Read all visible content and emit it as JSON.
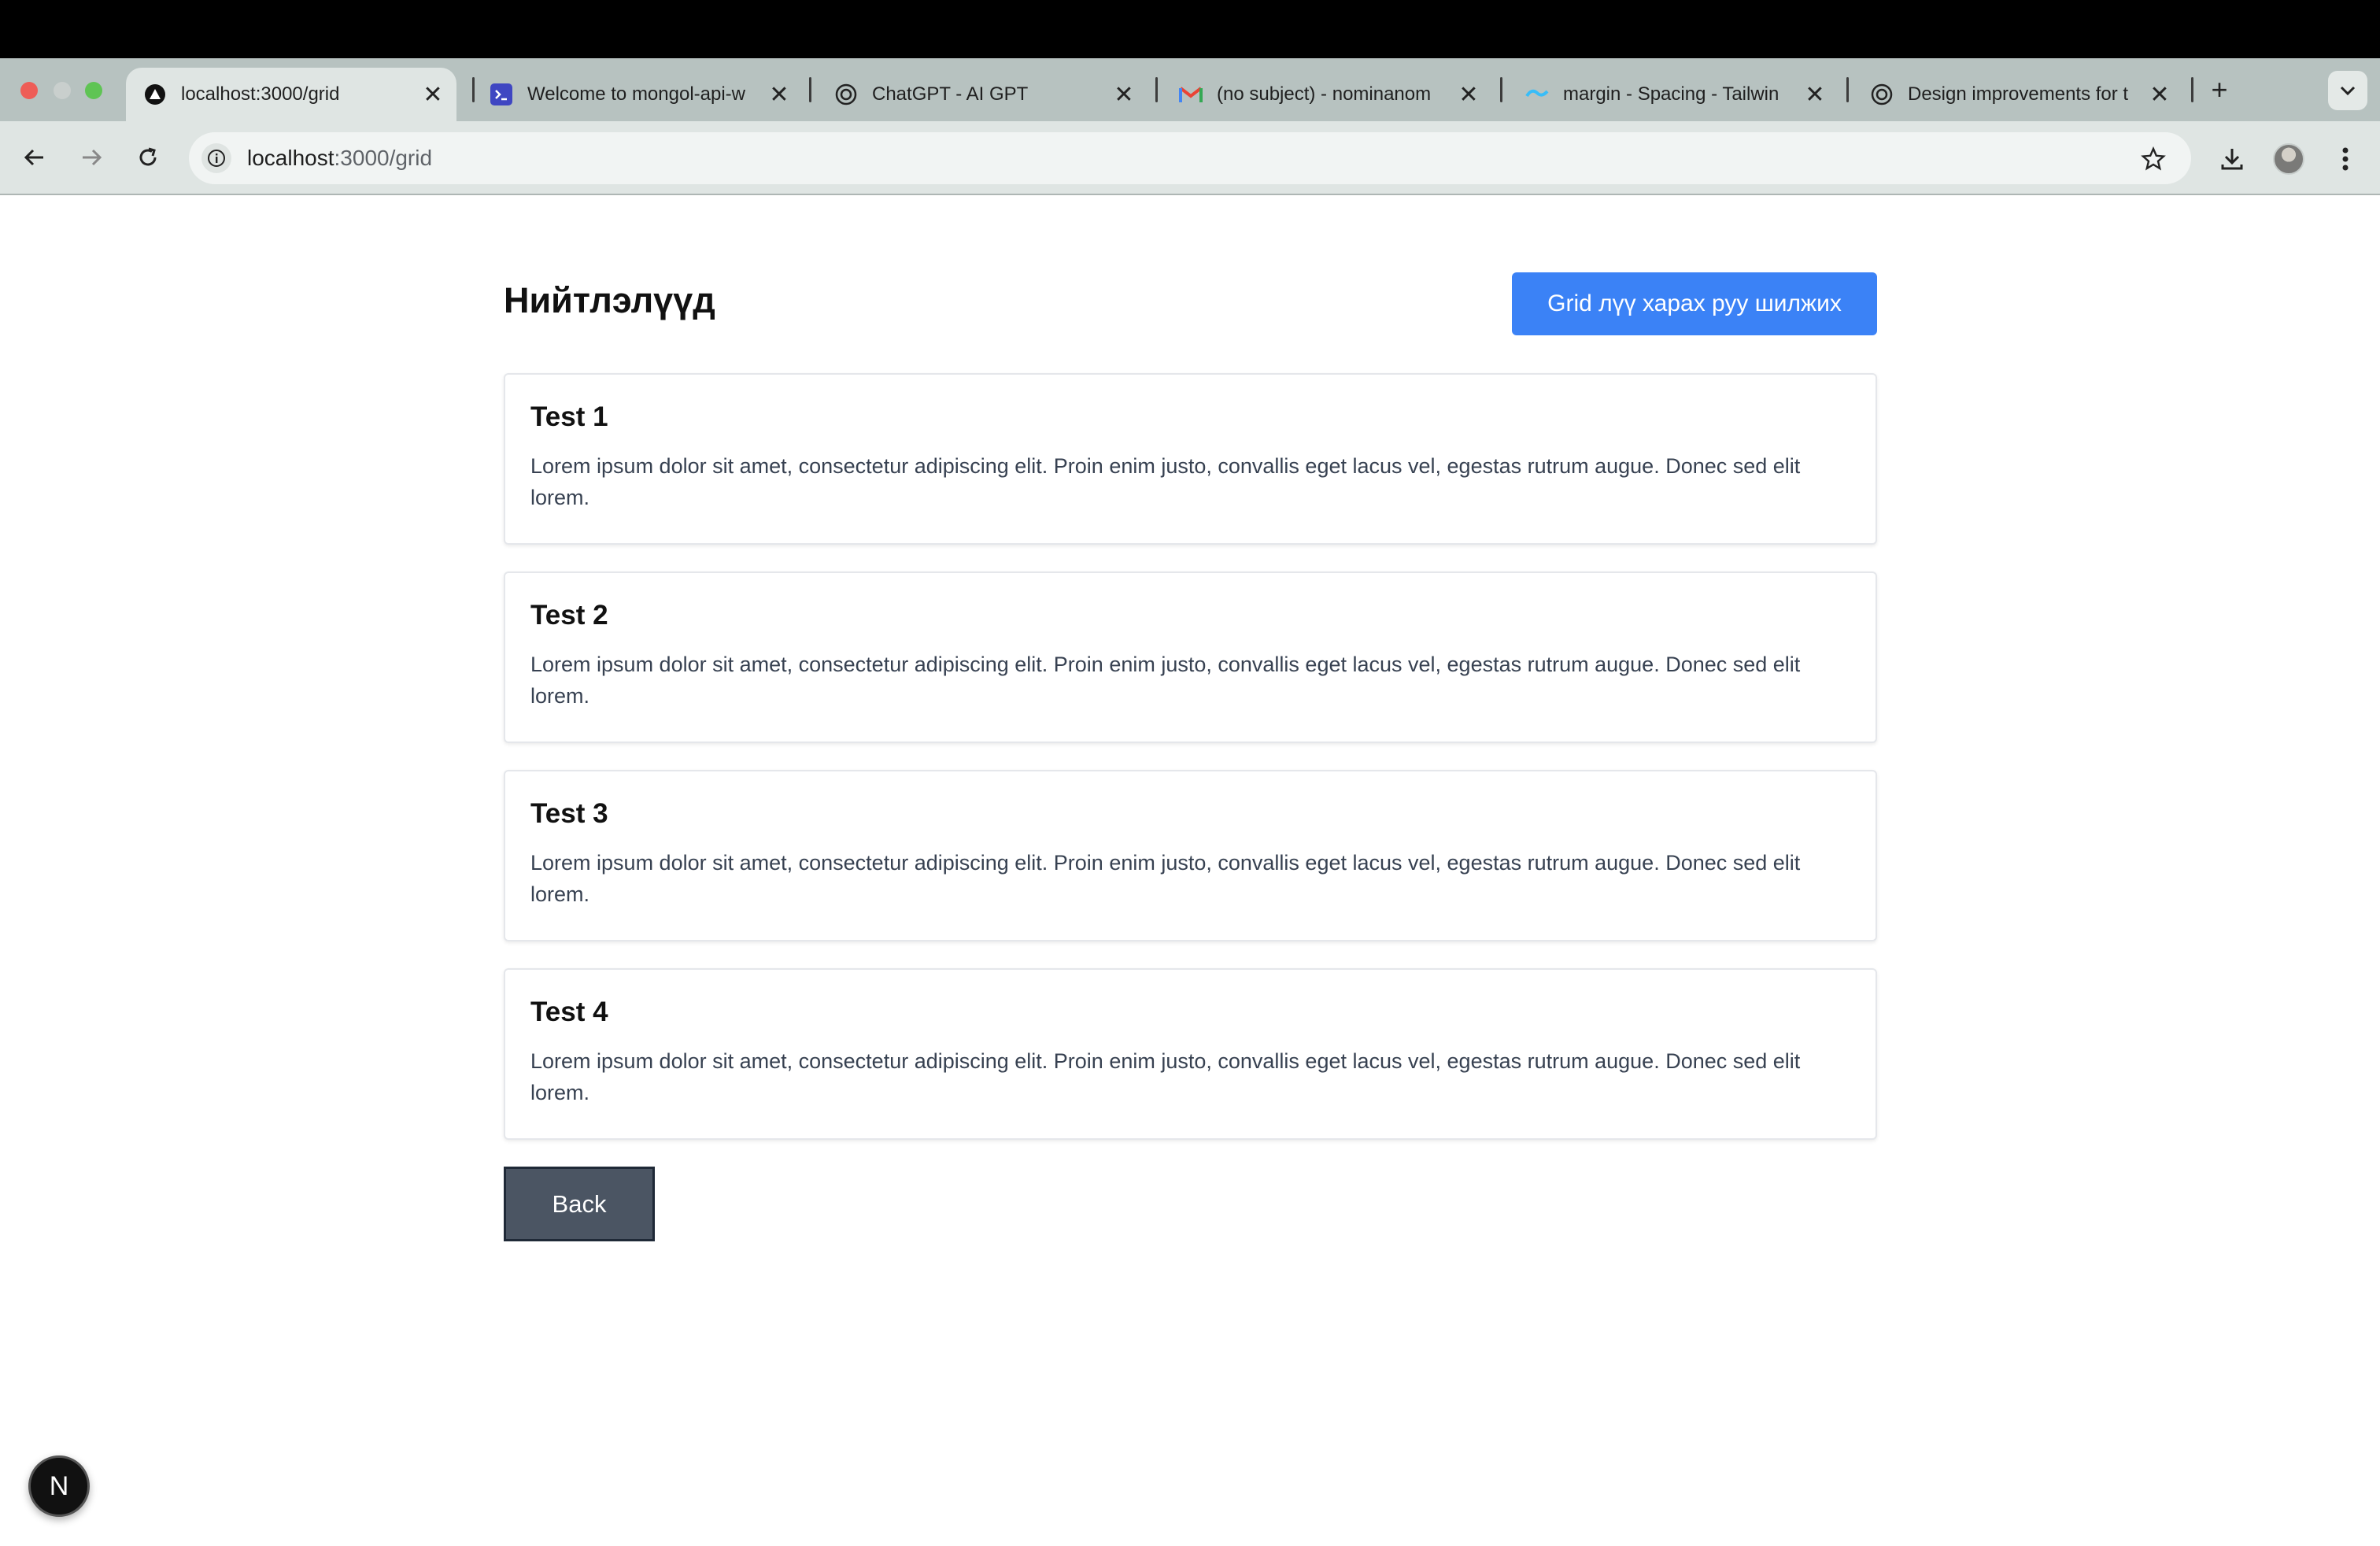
{
  "browser": {
    "tabs": [
      {
        "title": "localhost:3000/grid",
        "icon": "triangle-icon",
        "active": true
      },
      {
        "title": "Welcome to mongol-api-w",
        "icon": "terminal-icon"
      },
      {
        "title": "ChatGPT - AI GPT",
        "icon": "openai-icon"
      },
      {
        "title": "(no subject) - nominanom",
        "icon": "gmail-icon"
      },
      {
        "title": "margin - Spacing - Tailwin",
        "icon": "tailwind-icon"
      },
      {
        "title": "Design improvements for t",
        "icon": "openai-icon"
      }
    ],
    "tab_close_glyph": "✕",
    "new_tab_glyph": "+",
    "address": {
      "host": "localhost",
      "path": ":3000/grid"
    }
  },
  "page": {
    "title": "Нийтлэлүүд",
    "grid_button_label": "Grid лүү харах руу шилжих",
    "posts": [
      {
        "title": "Test 1",
        "body": "Lorem ipsum dolor sit amet, consectetur adipiscing elit. Proin enim justo, convallis eget lacus vel, egestas rutrum augue. Donec sed elit lorem."
      },
      {
        "title": "Test 2",
        "body": "Lorem ipsum dolor sit amet, consectetur adipiscing elit. Proin enim justo, convallis eget lacus vel, egestas rutrum augue. Donec sed elit lorem."
      },
      {
        "title": "Test 3",
        "body": "Lorem ipsum dolor sit amet, consectetur adipiscing elit. Proin enim justo, convallis eget lacus vel, egestas rutrum augue. Donec sed elit lorem."
      },
      {
        "title": "Test 4",
        "body": "Lorem ipsum dolor sit amet, consectetur adipiscing elit. Proin enim justo, convallis eget lacus vel, egestas rutrum augue. Donec sed elit lorem."
      }
    ],
    "back_button_label": "Back",
    "nextjs_badge": "N"
  },
  "colors": {
    "primary_button": "#3b82f6",
    "back_button": "#4b5563",
    "tabstrip": "#b7c2c0",
    "toolbar": "#dfe5e3"
  }
}
